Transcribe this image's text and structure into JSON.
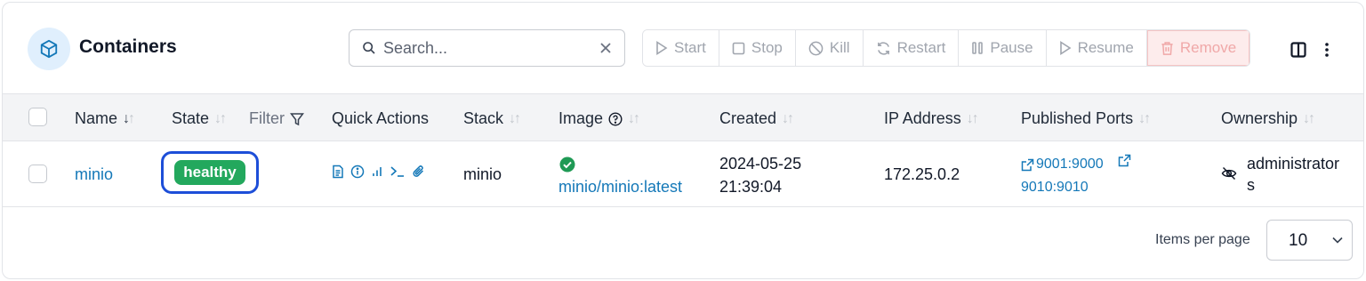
{
  "header": {
    "title": "Containers",
    "title_icon": "cube-icon",
    "search": {
      "placeholder": "Search...",
      "value": ""
    },
    "actions": [
      {
        "label": "Start",
        "icon": "play-icon"
      },
      {
        "label": "Stop",
        "icon": "stop-square-icon"
      },
      {
        "label": "Kill",
        "icon": "ban-icon"
      },
      {
        "label": "Restart",
        "icon": "refresh-icon"
      },
      {
        "label": "Pause",
        "icon": "pause-icon"
      },
      {
        "label": "Resume",
        "icon": "play-icon"
      },
      {
        "label": "Remove",
        "icon": "trash-icon"
      }
    ]
  },
  "table": {
    "columns": {
      "name": "Name",
      "state": "State",
      "state_filter": "Filter",
      "quick_actions": "Quick Actions",
      "stack": "Stack",
      "image": "Image",
      "created": "Created",
      "ip": "IP Address",
      "ports": "Published Ports",
      "ownership": "Ownership"
    },
    "rows": [
      {
        "name": "minio",
        "state": "healthy",
        "stack": "minio",
        "image": "minio/minio:latest",
        "created_date": "2024-05-25",
        "created_time": "21:39:04",
        "ip": "172.25.0.2",
        "ports": [
          "9001:9000",
          "9010:9010"
        ],
        "ownership_line1": "administrator",
        "ownership_line2": "s"
      }
    ]
  },
  "footer": {
    "items_per_page_label": "Items per page",
    "items_per_page_value": "10"
  },
  "colors": {
    "accent_link": "#1478b8",
    "healthy_badge": "#23a85d",
    "focus_ring": "#1d4ed8",
    "remove_bg": "#fdecec"
  }
}
